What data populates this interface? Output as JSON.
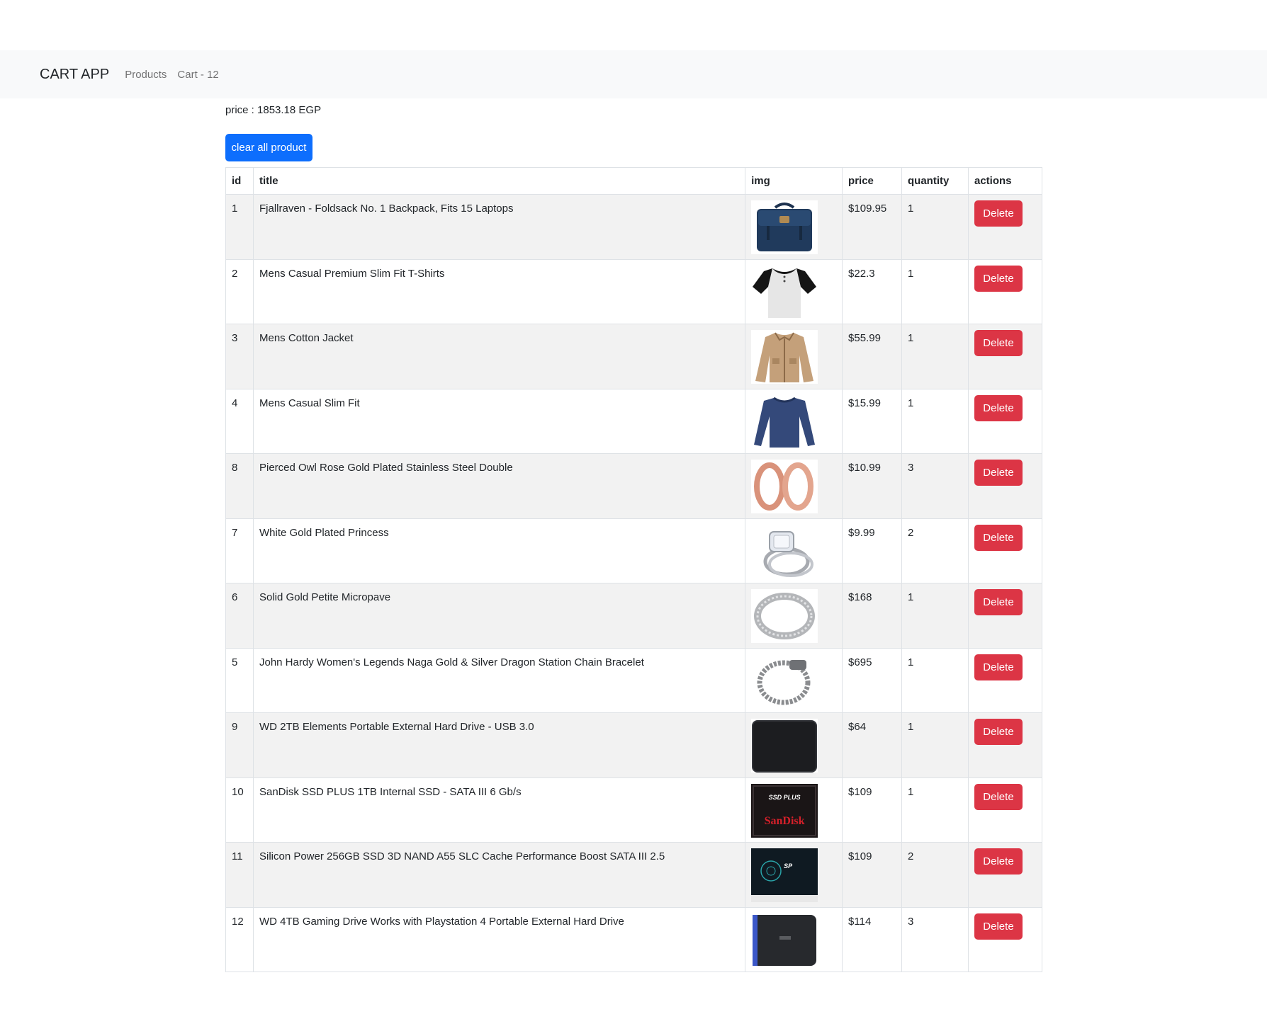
{
  "nav": {
    "brand": "CART APP",
    "links": [
      "Products",
      "Cart - 12"
    ]
  },
  "summary": {
    "price_text": "price : 1853.18 EGP"
  },
  "clear_button": "clear all product",
  "table": {
    "headers": [
      "id",
      "title",
      "img",
      "price",
      "quantity",
      "actions"
    ],
    "delete_label": "Delete",
    "rows": [
      {
        "id": "1",
        "title": "Fjallraven - Foldsack No. 1 Backpack, Fits 15 Laptops",
        "price": "$109.95",
        "quantity": "1",
        "icon": "backpack-image"
      },
      {
        "id": "2",
        "title": "Mens Casual Premium Slim Fit T-Shirts",
        "price": "$22.3",
        "quantity": "1",
        "icon": "tshirt-image"
      },
      {
        "id": "3",
        "title": "Mens Cotton Jacket",
        "price": "$55.99",
        "quantity": "1",
        "icon": "jacket-image"
      },
      {
        "id": "4",
        "title": "Mens Casual Slim Fit",
        "price": "$15.99",
        "quantity": "1",
        "icon": "longsleeve-image"
      },
      {
        "id": "8",
        "title": "Pierced Owl Rose Gold Plated Stainless Steel Double",
        "price": "$10.99",
        "quantity": "3",
        "icon": "earrings-image"
      },
      {
        "id": "7",
        "title": "White Gold Plated Princess",
        "price": "$9.99",
        "quantity": "2",
        "icon": "ring-diamond-image"
      },
      {
        "id": "6",
        "title": "Solid Gold Petite Micropave",
        "price": "$168",
        "quantity": "1",
        "icon": "ring-band-image"
      },
      {
        "id": "5",
        "title": "John Hardy Women's Legends Naga Gold & Silver Dragon Station Chain Bracelet",
        "price": "$695",
        "quantity": "1",
        "icon": "bracelet-image"
      },
      {
        "id": "9",
        "title": "WD 2TB Elements Portable External Hard Drive - USB 3.0",
        "price": "$64",
        "quantity": "1",
        "icon": "hard-drive-image"
      },
      {
        "id": "10",
        "title": "SanDisk SSD PLUS 1TB Internal SSD - SATA III 6 Gb/s",
        "price": "$109",
        "quantity": "1",
        "icon": "sandisk-ssd-image",
        "label_top": "SSD PLUS",
        "label_brand": "SanDisk"
      },
      {
        "id": "11",
        "title": "Silicon Power 256GB SSD 3D NAND A55 SLC Cache Performance Boost SATA III 2.5",
        "price": "$109",
        "quantity": "2",
        "icon": "silicon-power-ssd-image",
        "label_top": "SP"
      },
      {
        "id": "12",
        "title": "WD 4TB Gaming Drive Works with Playstation 4 Portable External Hard Drive",
        "price": "$114",
        "quantity": "3",
        "icon": "gaming-drive-image"
      }
    ]
  },
  "colors": {
    "primary": "#0d6efd",
    "danger": "#dc3545",
    "navbar_bg": "#f8f9fa",
    "stripe": "#f2f2f2"
  }
}
